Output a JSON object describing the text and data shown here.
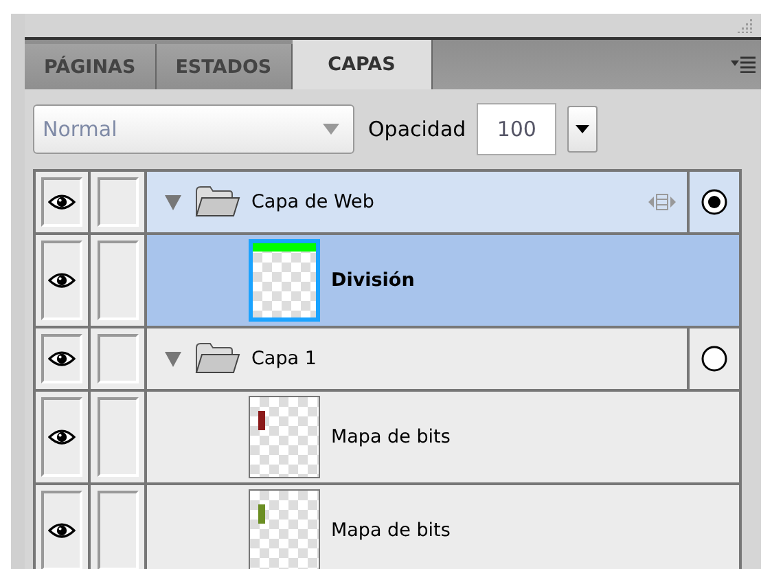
{
  "tabs": [
    {
      "label": "PÁGINAS",
      "selected": false
    },
    {
      "label": "ESTADOS",
      "selected": false
    },
    {
      "label": "CAPAS",
      "selected": true
    }
  ],
  "blend_mode": {
    "value": "Normal",
    "disabled": true
  },
  "opacity": {
    "label": "Opacidad",
    "value": "100"
  },
  "layers": [
    {
      "kind": "web",
      "name": "Capa de Web",
      "visible": true,
      "expanded": true,
      "current": true,
      "children": [
        {
          "kind": "bitmap",
          "name": "División",
          "visible": true,
          "selected": true,
          "color": "#00ff00"
        }
      ]
    },
    {
      "kind": "folder",
      "name": "Capa 1",
      "visible": true,
      "expanded": true,
      "current": false,
      "children": [
        {
          "kind": "bitmap",
          "name": "Mapa de bits",
          "visible": true,
          "selected": false,
          "color": "#8b1a1a"
        },
        {
          "kind": "bitmap",
          "name": "Mapa de bits",
          "visible": true,
          "selected": false,
          "color": "#6b8e23"
        }
      ]
    }
  ]
}
